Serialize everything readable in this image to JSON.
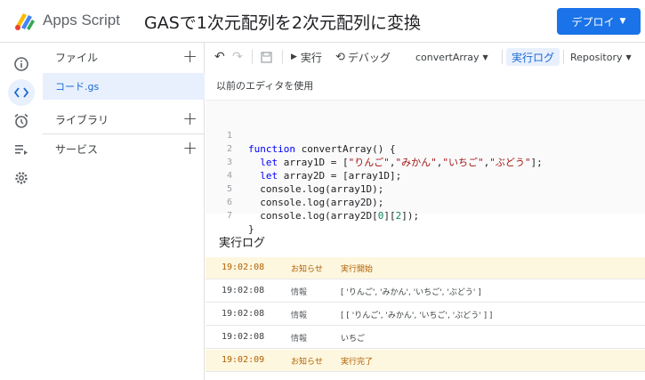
{
  "header": {
    "app_name": "Apps Script",
    "project_title": "GASで1次元配列を2次元配列に変換",
    "deploy_label": "デプロイ"
  },
  "rail": {
    "items": [
      "overview-icon",
      "editor-icon",
      "triggers-icon",
      "executions-icon",
      "settings-icon"
    ]
  },
  "files_panel": {
    "files_label": "ファイル",
    "file_name": "コード.gs",
    "libraries_label": "ライブラリ",
    "services_label": "サービス"
  },
  "toolbar": {
    "run_label": "実行",
    "debug_label": "デバッグ",
    "function_name": "convertArray",
    "log_label": "実行ログ",
    "repository_label": "Repository"
  },
  "legacy_link": "以前のエディタを使用",
  "editor": {
    "line_numbers": [
      "1",
      "2",
      "3",
      "4",
      "5",
      "6",
      "7"
    ]
  },
  "log": {
    "title": "実行ログ",
    "entries": [
      {
        "time": "19:02:08",
        "level": "お知らせ",
        "message": "実行開始",
        "type": "notice"
      },
      {
        "time": "19:02:08",
        "level": "情報",
        "message": "[ 'りんご', 'みかん', 'いちご', 'ぶどう' ]",
        "type": "info"
      },
      {
        "time": "19:02:08",
        "level": "情報",
        "message": "[ [ 'りんご', 'みかん', 'いちご', 'ぶどう' ] ]",
        "type": "info"
      },
      {
        "time": "19:02:08",
        "level": "情報",
        "message": "いちご",
        "type": "info"
      },
      {
        "time": "19:02:09",
        "level": "お知らせ",
        "message": "実行完了",
        "type": "notice"
      }
    ]
  },
  "colors": {
    "accent": "#1a73e8",
    "selected_bg": "#e8f0fe",
    "notice_bg": "#fef7e0"
  }
}
